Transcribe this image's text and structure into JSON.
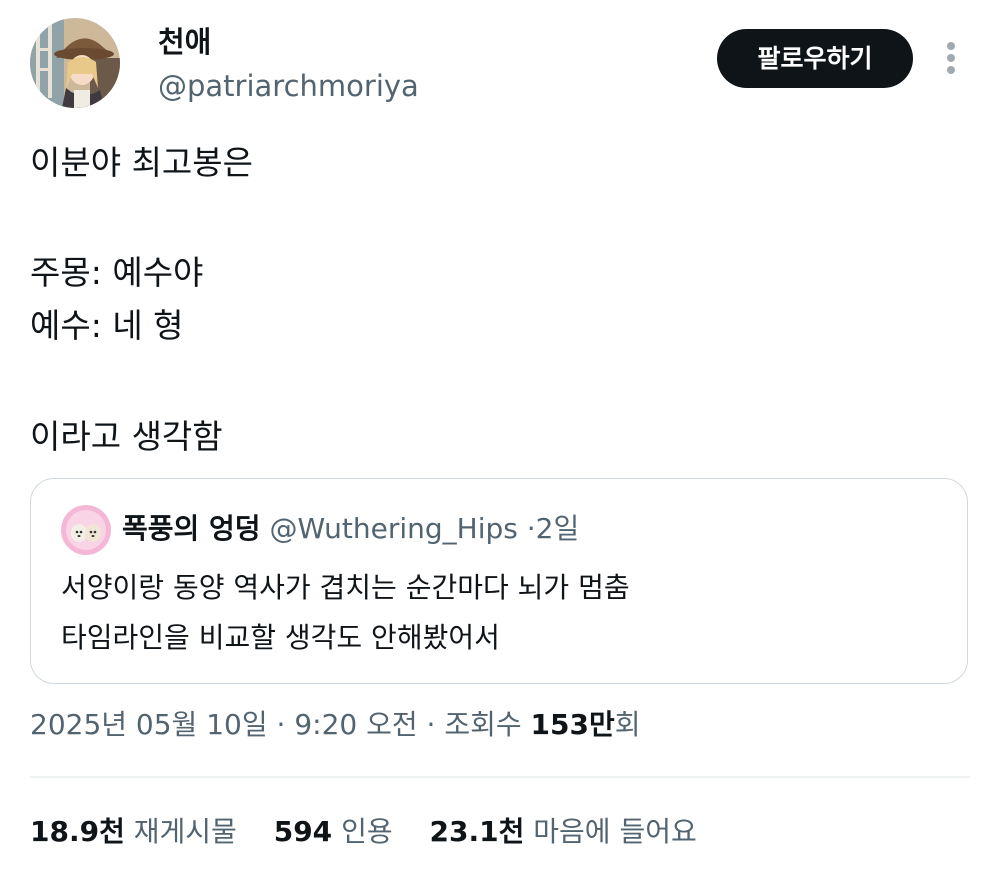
{
  "author": {
    "display_name": "천애",
    "handle": "@patriarchmoriya",
    "avatar_icon": "anime-witch-avatar"
  },
  "follow_button": {
    "label": "팔로우하기"
  },
  "more_button": {
    "icon": "more-vertical-icon"
  },
  "tweet": {
    "lines": [
      "이분야 최고봉은",
      "",
      "주몽: 예수야",
      "예수: 네 형",
      "",
      "이라고 생각함"
    ]
  },
  "quote": {
    "display_name": "폭풍의 엉덩",
    "handle": "@Wuthering_Hips",
    "separator": "·",
    "time": "2일",
    "avatar_icon": "puppies-avatar",
    "lines": [
      "서양이랑 동양 역사가 겹치는 순간마다 뇌가 멈춤",
      "타임라인을 비교할 생각도 안해봤어서"
    ]
  },
  "meta": {
    "date": "2025년 05월 10일",
    "separator": "·",
    "time": "9:20 오전",
    "views_label": "조회수",
    "views_count": "153만",
    "views_suffix": "회"
  },
  "stats": {
    "reposts": {
      "count": "18.9천",
      "label": "재게시물"
    },
    "quotes": {
      "count": "594",
      "label": "인용"
    },
    "likes": {
      "count": "23.1천",
      "label": "마음에 들어요"
    }
  },
  "colors": {
    "text_primary": "#0f1419",
    "text_secondary": "#536471",
    "border": "#cfd9de",
    "follow_button_bg": "#0f1419",
    "follow_button_text": "#ffffff"
  }
}
